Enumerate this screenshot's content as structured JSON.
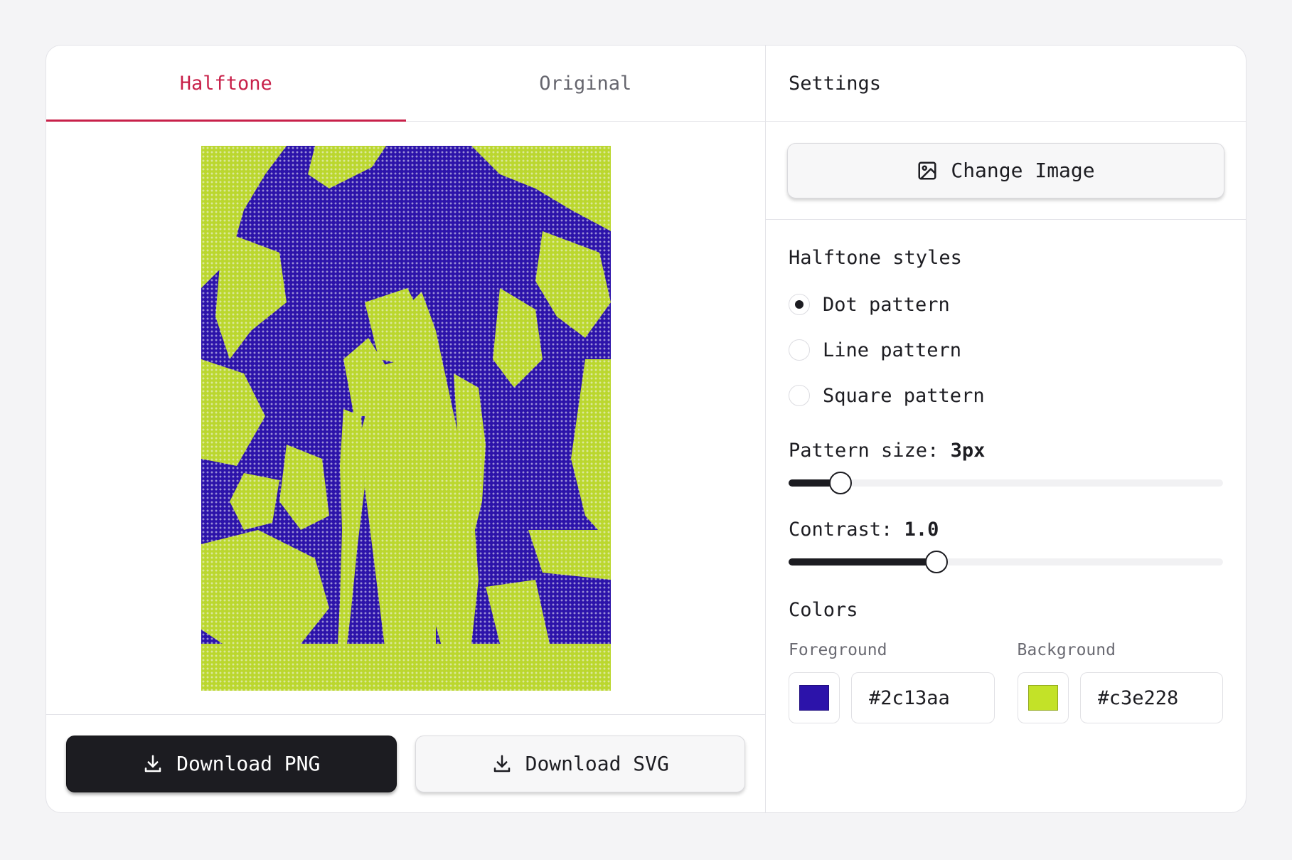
{
  "tabs": [
    {
      "label": "Halftone",
      "active": true
    },
    {
      "label": "Original",
      "active": false
    }
  ],
  "preview": {
    "foreground": "#2c13aa",
    "background": "#c3e228"
  },
  "downloads": {
    "png_label": "Download PNG",
    "svg_label": "Download SVG"
  },
  "settings": {
    "title": "Settings",
    "change_image_label": "Change Image",
    "styles_title": "Halftone styles",
    "styles": [
      {
        "label": "Dot pattern",
        "checked": true
      },
      {
        "label": "Line pattern",
        "checked": false
      },
      {
        "label": "Square pattern",
        "checked": false
      }
    ],
    "pattern_size": {
      "label": "Pattern size:",
      "value": "3px",
      "fraction": 0.12
    },
    "contrast": {
      "label": "Contrast:",
      "value": "1.0",
      "fraction": 0.34
    },
    "colors_title": "Colors",
    "foreground": {
      "label": "Foreground",
      "hex": "#2c13aa"
    },
    "background": {
      "label": "Background",
      "hex": "#c3e228"
    }
  },
  "colors": {
    "accent": "#c8214a",
    "dark_button": "#1c1c21"
  }
}
